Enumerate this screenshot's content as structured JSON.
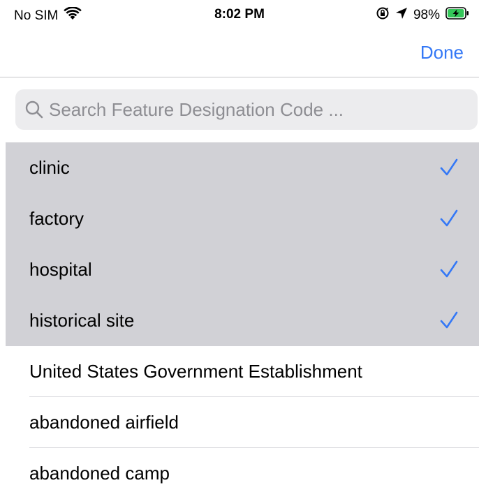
{
  "status_bar": {
    "carrier": "No SIM",
    "time": "8:02 PM",
    "battery_percent": "98%",
    "battery_level": 0.98
  },
  "nav": {
    "done_label": "Done"
  },
  "search": {
    "placeholder": "Search Feature Designation Code ..."
  },
  "selected_items": [
    {
      "label": "clinic",
      "checked": true
    },
    {
      "label": "factory",
      "checked": true
    },
    {
      "label": "hospital",
      "checked": true
    },
    {
      "label": "historical site",
      "checked": true
    }
  ],
  "unselected_items": [
    {
      "label": "United States Government Establishment"
    },
    {
      "label": "abandoned airfield"
    },
    {
      "label": "abandoned camp"
    }
  ],
  "colors": {
    "accent": "#3478f6",
    "selected_row": "#d1d1d6",
    "battery": "#34c759"
  }
}
